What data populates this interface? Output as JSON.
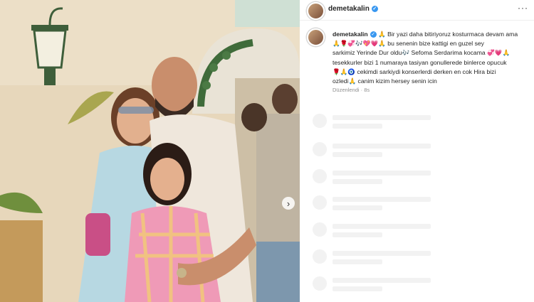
{
  "post": {
    "username": "demetakalin",
    "verified": true,
    "caption_user": "demetakalin",
    "caption_lines": [
      "🙏 Bir yazi daha bitiriyoruz kosturmaca devam ama",
      "🙏🌹💞🎶💖💗🙏 bu senenin bize kattigi en guzel sey",
      "sarkimiz Yerinde Dur oldu🎶 Sefoma Serdarima kocama 💞💗🙏",
      "tesekkurler bizi 1 numaraya tasiyan gonullerede binlerce opucuk",
      "🌹🙏🧿 cekimdi sarkiydi konserlerdi derken en cok Hira bizi",
      "ozledi🙏 canim kizim hersey senin icin"
    ],
    "meta": "Düzenlendi · 8s"
  },
  "icons": {
    "verified": "verified-badge-icon",
    "more": "more-options-icon",
    "next": "chevron-right-icon"
  },
  "colors": {
    "verified": "#3897f0",
    "text": "#262626",
    "muted": "#8e8e8e",
    "skeleton": "#f2f2f2"
  }
}
